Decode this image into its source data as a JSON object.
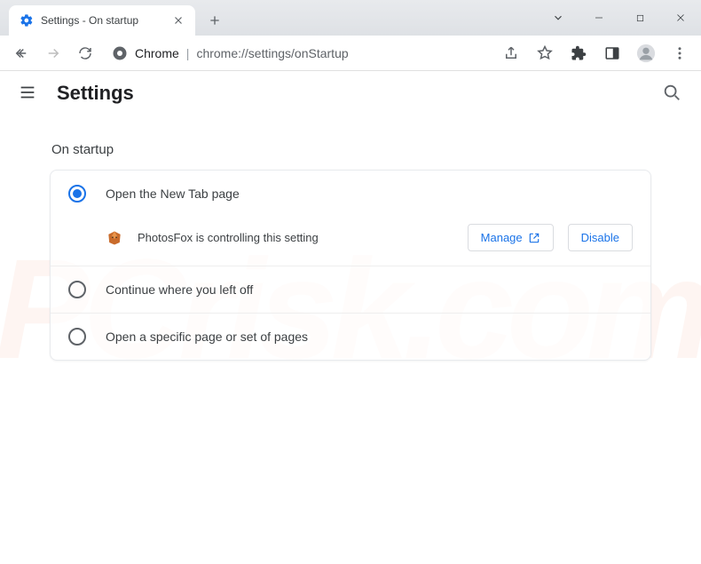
{
  "window": {
    "tab_title": "Settings - On startup",
    "url_host": "Chrome",
    "url_path": "chrome://settings/onStartup"
  },
  "header": {
    "title": "Settings"
  },
  "section": {
    "title": "On startup"
  },
  "options": {
    "open_new_tab": "Open the New Tab page",
    "continue": "Continue where you left off",
    "specific": "Open a specific page or set of pages"
  },
  "extension": {
    "message": "PhotosFox is controlling this setting",
    "manage_label": "Manage",
    "disable_label": "Disable"
  }
}
